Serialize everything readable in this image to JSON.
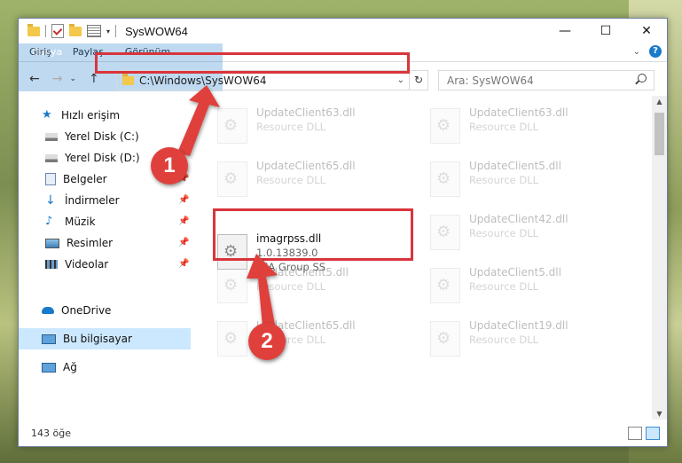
{
  "window": {
    "title": "SysWOW64",
    "controls": {
      "minimize": "—",
      "maximize": "☐",
      "close": "✕"
    }
  },
  "ribbon": {
    "tabs": [
      "Dosya",
      "Giriş",
      "Paylaş",
      "Görünüm"
    ],
    "help": "?"
  },
  "address": {
    "path": "C:\\Windows\\SysWOW64",
    "search_placeholder": "Ara: SysWOW64"
  },
  "navpane": {
    "items": [
      {
        "label": "Hızlı erişim",
        "icon": "star-icon"
      },
      {
        "label": "Yerel Disk (C:)",
        "icon": "drive-icon"
      },
      {
        "label": "Yerel Disk (D:)",
        "icon": "drive-icon"
      },
      {
        "label": "Belgeler",
        "icon": "documents-icon"
      },
      {
        "label": "İndirmeler",
        "icon": "download-icon"
      },
      {
        "label": "Müzik",
        "icon": "music-icon"
      },
      {
        "label": "Resimler",
        "icon": "pictures-icon"
      },
      {
        "label": "Videolar",
        "icon": "video-icon"
      },
      {
        "label": "OneDrive",
        "icon": "cloud-icon"
      },
      {
        "label": "Bu bilgisayar",
        "icon": "computer-icon"
      },
      {
        "label": "Ağ",
        "icon": "network-icon"
      }
    ]
  },
  "files": {
    "faded": [
      {
        "name": "UpdateClient63.dll",
        "type": "Resource DLL"
      },
      {
        "name": "UpdateClient63.dll",
        "type": "Resource DLL"
      },
      {
        "name": "UpdateClient65.dll",
        "type": "Resource DLL"
      },
      {
        "name": "UpdateClient5.dll",
        "type": "Resource DLL"
      },
      {
        "name": "UpdateClient42.dll",
        "type": "Resource DLL"
      },
      {
        "name": "UpdateClient5.dll",
        "type": "Resource DLL"
      },
      {
        "name": "UpdateClient5.dll",
        "type": "Resource DLL"
      },
      {
        "name": "UpdateClient65.dll",
        "type": "Resource DLL"
      },
      {
        "name": "UpdateClient19.dll",
        "type": "Resource DLL"
      }
    ],
    "selected": {
      "name": "imagrpss.dll",
      "version": "1.0.13839.0",
      "company": "IMA Group SS"
    }
  },
  "status": {
    "count": "143 öğe"
  },
  "callouts": {
    "one": "1",
    "two": "2"
  },
  "colors": {
    "accent": "#1979ca",
    "highlight": "#d9343c"
  }
}
